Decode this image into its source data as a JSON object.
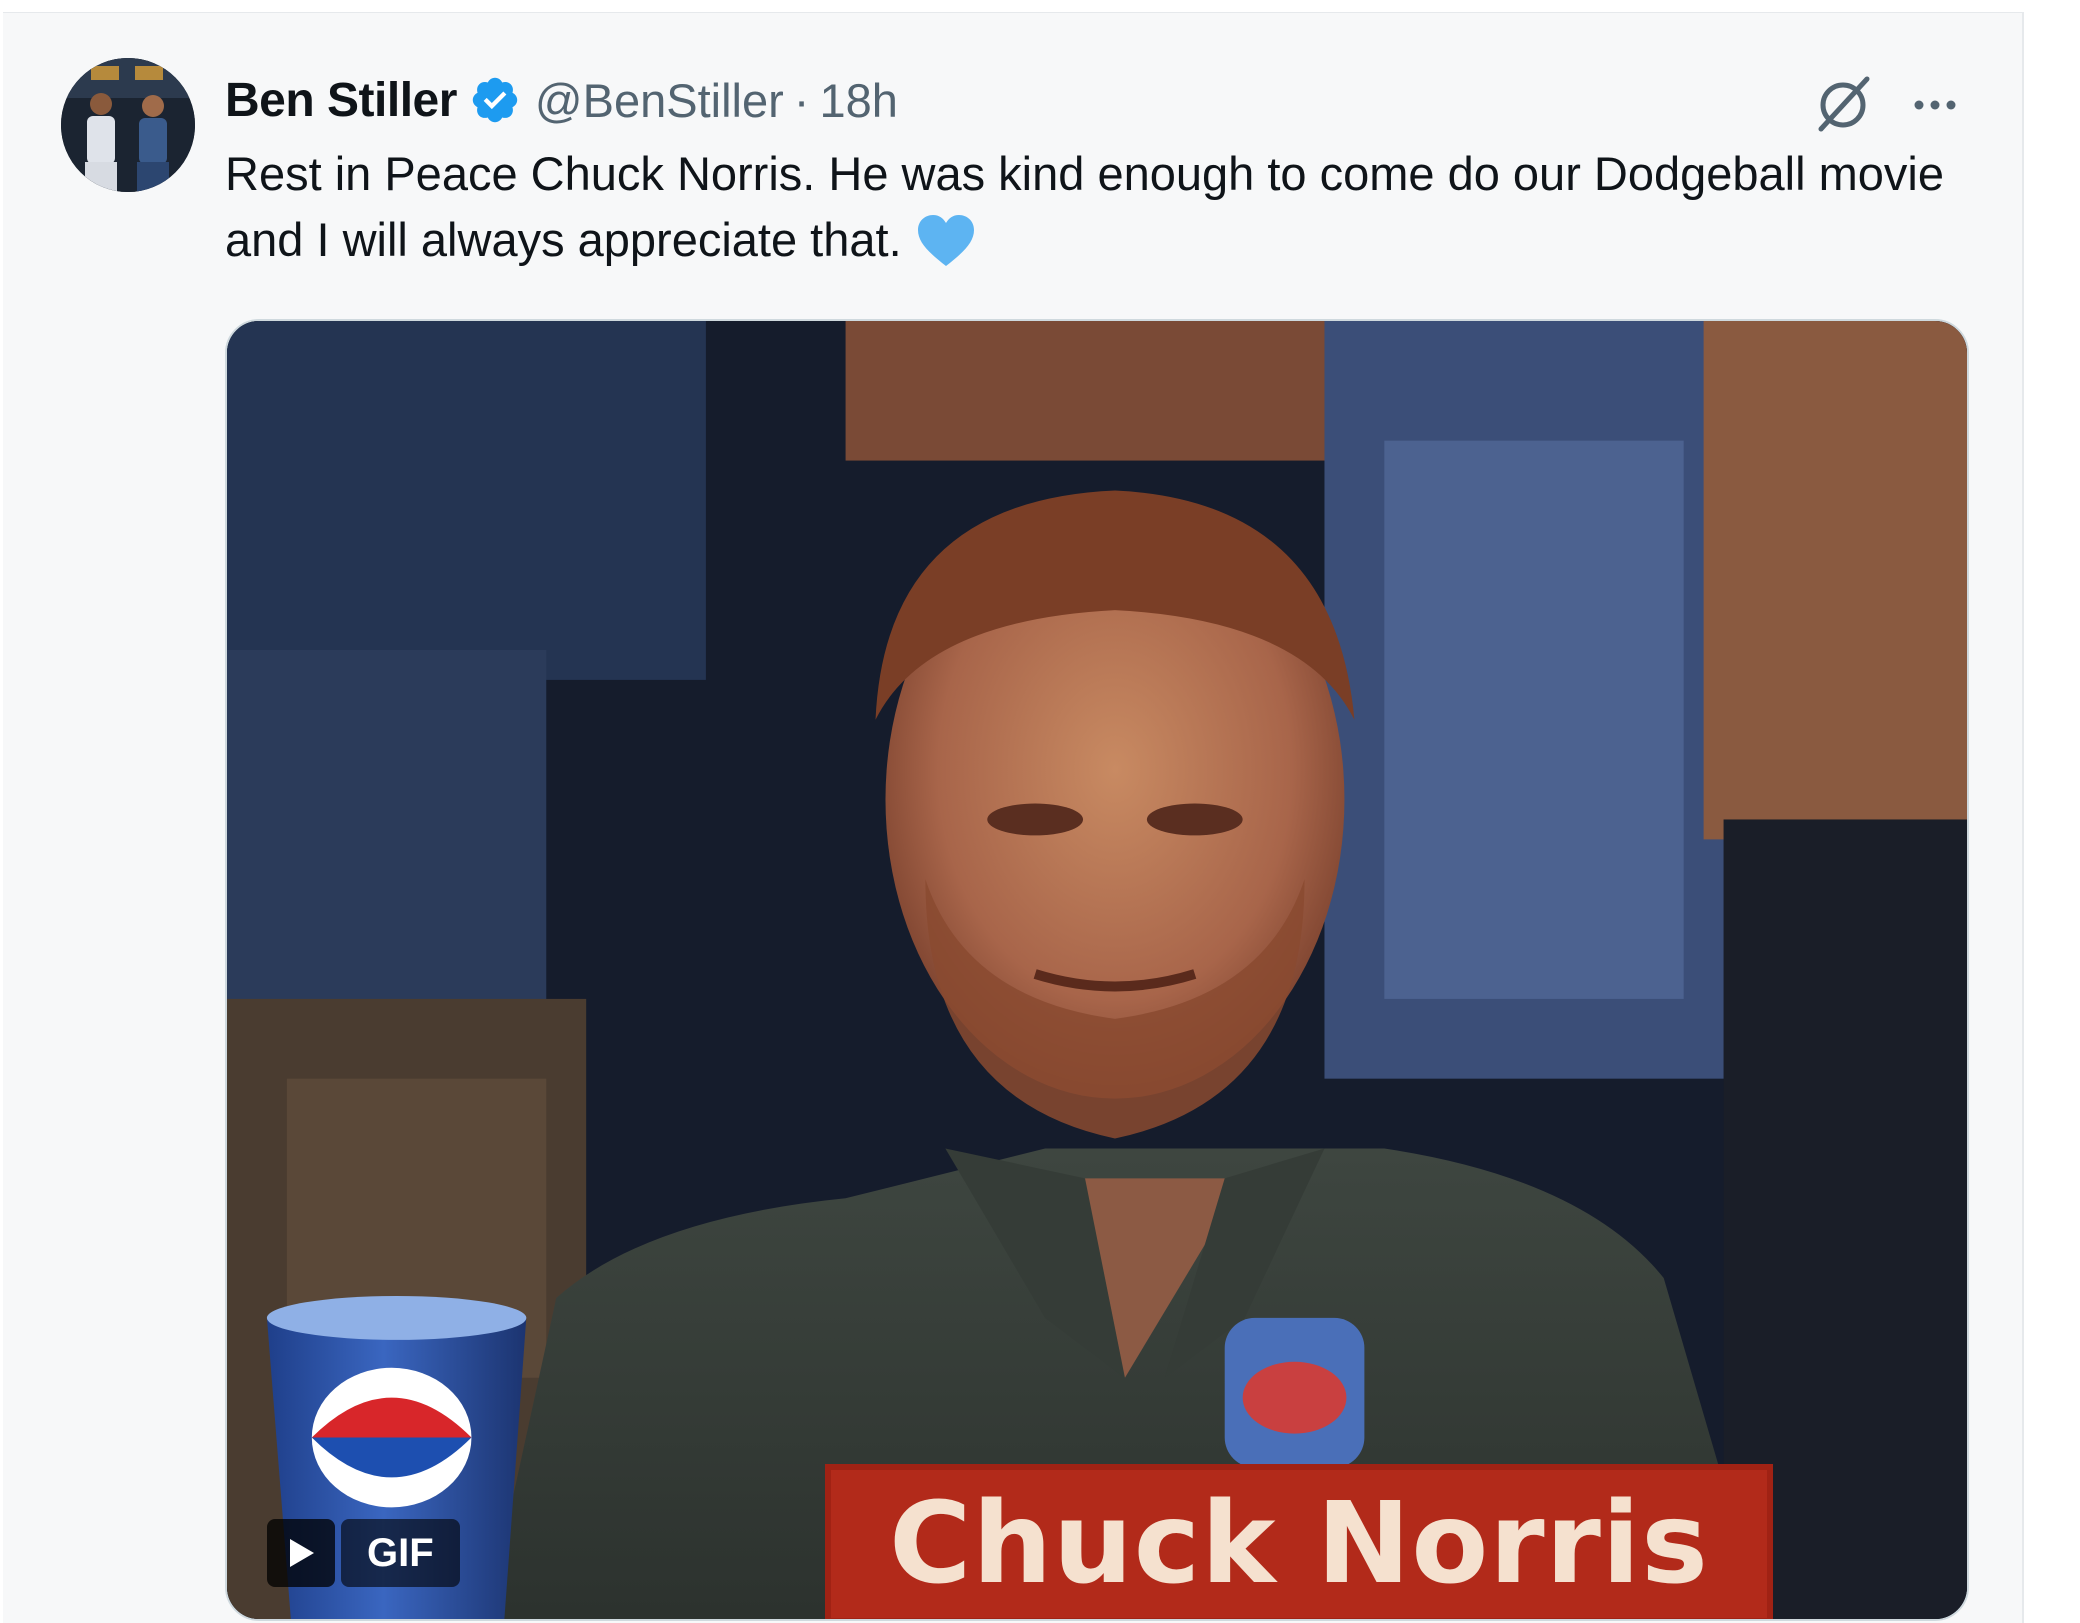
{
  "tweet": {
    "author": {
      "display_name": "Ben Stiller",
      "handle": "@BenStiller",
      "verified": true
    },
    "separator": "·",
    "timestamp": "18h",
    "text": "Rest in Peace Chuck Norris. He was kind enough to come do our Dodgeball movie and I will always appreciate that.",
    "emoji": "blue-heart",
    "media": {
      "type": "gif",
      "badge_label": "GIF",
      "caption_text": "Chuck Norris"
    }
  },
  "colors": {
    "background": "#f7f8f9",
    "text_primary": "#0f1419",
    "text_secondary": "#536471",
    "verified_blue": "#1d9bf0",
    "heart_blue": "#5db4f2",
    "caption_red": "#b22a1a"
  }
}
